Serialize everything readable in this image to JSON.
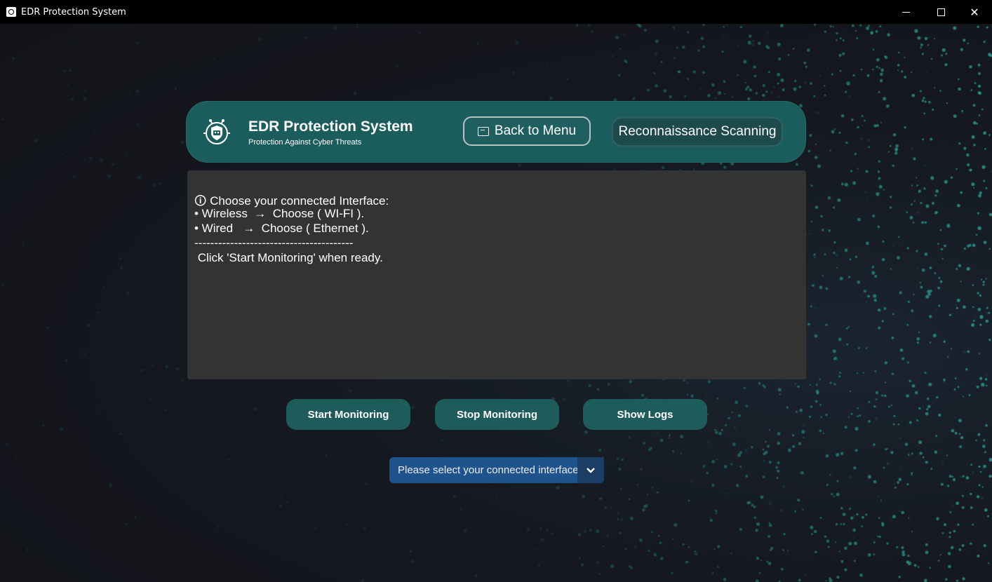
{
  "window": {
    "title": "EDR Protection System",
    "minimize_icon": "minimize-icon",
    "maximize_icon": "maximize-icon",
    "close_icon": "close-icon"
  },
  "header": {
    "title": "EDR Protection System",
    "subtitle": "Protection Against Cyber Threats",
    "logo_icon": "robot-shield-icon",
    "back_label": "Back to Menu",
    "recon_label": "Reconnaissance Scanning"
  },
  "info": {
    "lines": [
      "🛈 Choose your connected Interface:",
      "• Wireless  →  Choose ( WI-FI ).",
      "• Wired   →  Choose ( Ethernet ).",
      "----------------------------------------",
      " Click 'Start Monitoring' when ready."
    ]
  },
  "actions": {
    "start_label": "Start Monitoring",
    "stop_label": "Stop Monitoring",
    "logs_label": "Show Logs"
  },
  "interface_select": {
    "value": "Please select your connected interface",
    "arrow_icon": "chevron-down-icon"
  },
  "colors": {
    "accent": "#1b5c5c",
    "panel": "#333333",
    "dropdown": "#1f538d",
    "dots": "#2a9a8e"
  }
}
